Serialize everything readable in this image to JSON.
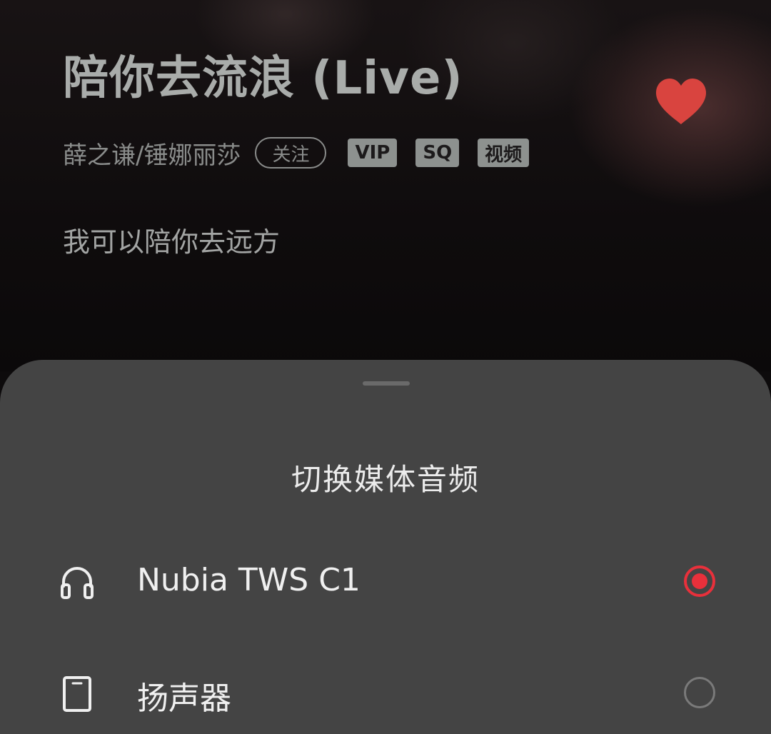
{
  "player": {
    "title": "陪你去流浪 (Live)",
    "artist": "薛之谦/锤娜丽莎",
    "follow_label": "关注",
    "tags": [
      "VIP",
      "SQ",
      "视频"
    ],
    "lyric": "我可以陪你去远方",
    "favorite_icon": "heart-icon",
    "favorite_color": "#d9443f"
  },
  "sheet": {
    "title": "切换媒体音频",
    "options": [
      {
        "label": "Nubia TWS C1",
        "icon": "headphones-icon",
        "selected": true
      },
      {
        "label": "扬声器",
        "icon": "phone-speaker-icon",
        "selected": false
      }
    ],
    "accent_color": "#e8303b"
  }
}
